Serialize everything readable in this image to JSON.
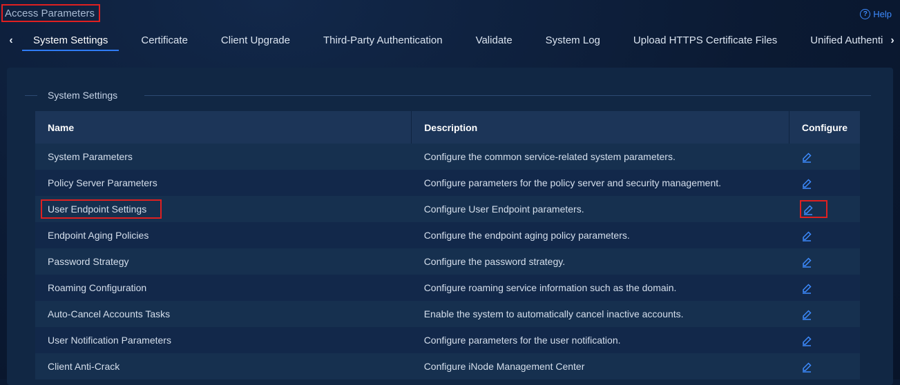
{
  "header": {
    "title": "Access Parameters",
    "help_label": "Help"
  },
  "tabs": [
    {
      "label": "System Settings",
      "active": true
    },
    {
      "label": "Certificate"
    },
    {
      "label": "Client Upgrade"
    },
    {
      "label": "Third-Party Authentication"
    },
    {
      "label": "Validate"
    },
    {
      "label": "System Log"
    },
    {
      "label": "Upload HTTPS Certificate Files"
    },
    {
      "label": "Unified Authenti"
    }
  ],
  "section": {
    "title": "System Settings"
  },
  "table": {
    "columns": [
      "Name",
      "Description",
      "Configure"
    ],
    "rows": [
      {
        "name": "System Parameters",
        "description": "Configure the common service-related system parameters."
      },
      {
        "name": "Policy Server Parameters",
        "description": "Configure parameters for the policy server and security management."
      },
      {
        "name": "User Endpoint Settings",
        "description": "Configure User Endpoint parameters."
      },
      {
        "name": "Endpoint Aging Policies",
        "description": "Configure the endpoint aging policy parameters."
      },
      {
        "name": "Password Strategy",
        "description": "Configure the password strategy."
      },
      {
        "name": "Roaming Configuration",
        "description": "Configure roaming service information such as the domain."
      },
      {
        "name": "Auto-Cancel Accounts Tasks",
        "description": "Enable the system to automatically cancel inactive accounts."
      },
      {
        "name": "User Notification Parameters",
        "description": "Configure parameters for the user notification."
      },
      {
        "name": "Client Anti-Crack",
        "description": "Configure iNode Management Center"
      }
    ]
  },
  "icons": {
    "edit": "pencil-edit-icon",
    "help": "question-circle-icon",
    "prev": "chevron-left-icon",
    "next": "chevron-right-icon"
  },
  "colors": {
    "accent": "#2f7cf6",
    "highlight": "#e02020",
    "background": "#0b1a33"
  }
}
